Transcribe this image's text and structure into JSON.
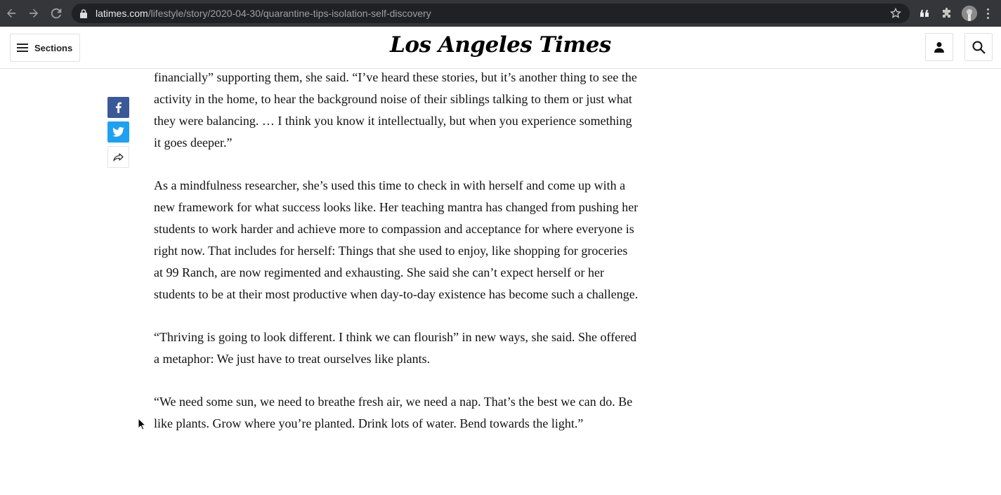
{
  "browser": {
    "url_host": "latimes.com",
    "url_path": "/lifestyle/story/2020-04-30/quarantine-tips-isolation-self-discovery",
    "icons": [
      "back-icon",
      "forward-icon",
      "reload-icon",
      "lock-icon",
      "star-icon",
      "quote-extension-icon",
      "puzzle-extension-icon",
      "profile-avatar",
      "kebab-menu-icon"
    ]
  },
  "header": {
    "sections_label": "Sections",
    "logo_text": "Los Angeles Times",
    "icons": [
      "hamburger-icon",
      "user-icon",
      "search-icon"
    ]
  },
  "share": {
    "icons": [
      "facebook-icon",
      "twitter-icon",
      "share-arrow-icon"
    ],
    "facebook_color": "#3b5998",
    "twitter_color": "#1da1f2"
  },
  "article": {
    "paragraphs": [
      "financially” supporting them, she said. “I’ve heard these stories, but it’s another thing to see the activity in the home, to hear the background noise of their siblings talking to them or just what they were balancing. … I think you know it intellectually, but when you experience something it goes deeper.”",
      "As a mindfulness researcher, she’s used this time to check in with herself and come up with a new framework for what success looks like. Her teaching mantra has changed from pushing her students to work harder and achieve more to compassion and acceptance for where everyone is right now. That includes for herself: Things that she used to enjoy, like shopping for groceries at 99 Ranch, are now regimented and exhausting. She said she can’t expect herself or her students to be at their most productive when day-to-day existence has become such a challenge.",
      "“Thriving is going to look different. I think we can flourish” in new ways, she said. She offered a metaphor: We just have to treat ourselves like plants.",
      "“We need some sun, we need to breathe fresh air, we need a nap. That’s the best we can do. Be like plants. Grow where you’re planted. Drink lots of water. Bend towards the light.”"
    ]
  }
}
